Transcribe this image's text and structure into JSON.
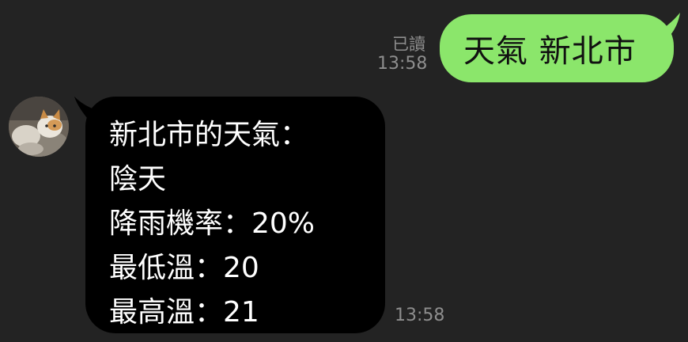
{
  "outgoing": {
    "text": "天氣 新北市",
    "read_status": "已讀",
    "time": "13:58",
    "bubble_color": "#8BE66B"
  },
  "incoming": {
    "lines": [
      "新北市的天氣：",
      "陰天",
      "降雨機率：20%",
      "最低溫：20",
      "最高溫：21"
    ],
    "time": "13:58",
    "bubble_color": "#000000"
  },
  "sender": {
    "avatar_icon": "cat-photo-avatar"
  },
  "theme": {
    "background": "#232323",
    "meta_text_color": "#8E8E8E"
  }
}
